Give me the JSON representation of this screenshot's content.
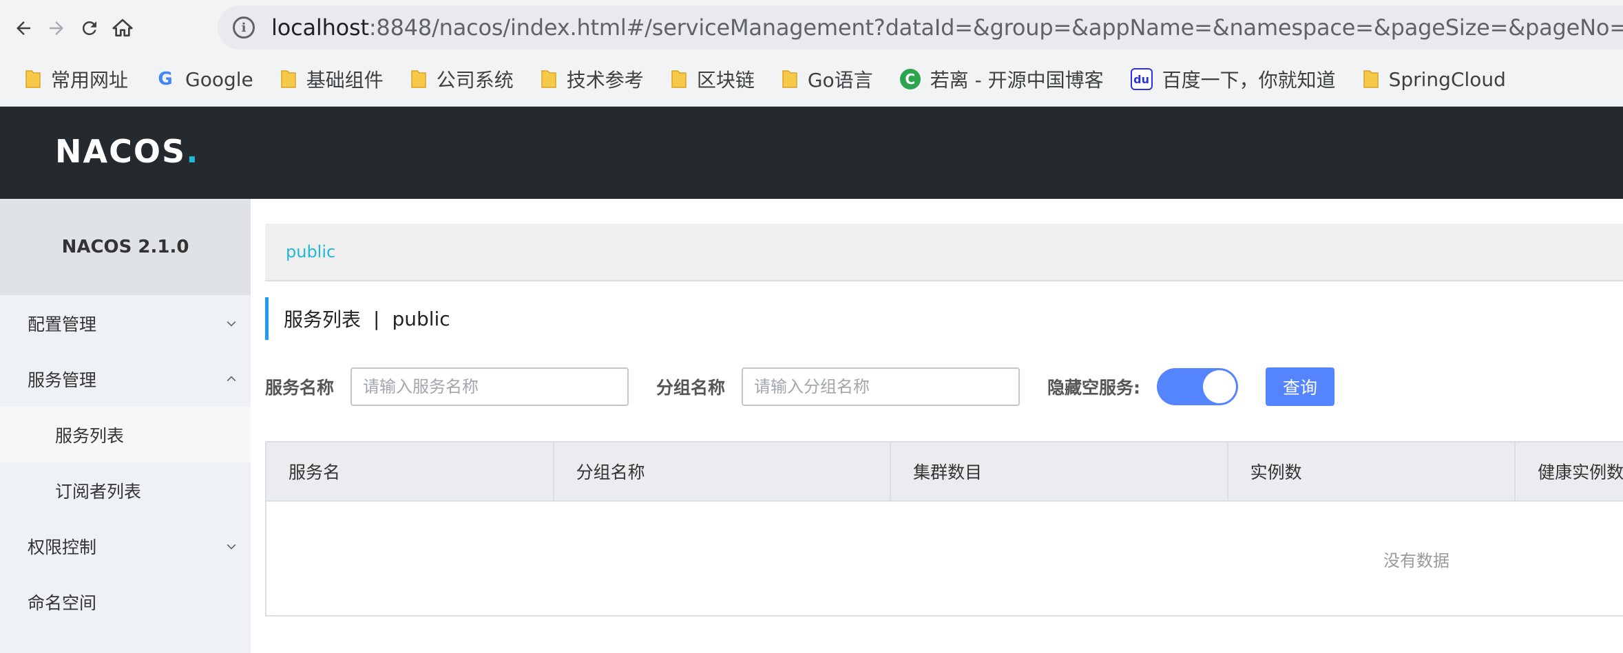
{
  "browser": {
    "url_host": "localhost",
    "url_rest": ":8848/nacos/index.html#/serviceManagement?dataId=&group=&appName=&namespace=&pageSize=&pageNo=",
    "bookmarks": [
      {
        "label": "常用网址",
        "icon": "folder-icon"
      },
      {
        "label": "Google",
        "icon": "google-icon"
      },
      {
        "label": "基础组件",
        "icon": "folder-icon"
      },
      {
        "label": "公司系统",
        "icon": "folder-icon"
      },
      {
        "label": "技术参考",
        "icon": "folder-icon"
      },
      {
        "label": "区块链",
        "icon": "folder-icon"
      },
      {
        "label": "Go语言",
        "icon": "folder-icon"
      },
      {
        "label": "若离 - 开源中国博客",
        "icon": "oschina-icon"
      },
      {
        "label": "百度一下，你就知道",
        "icon": "baidu-icon"
      },
      {
        "label": "SpringCloud",
        "icon": "folder-icon"
      }
    ]
  },
  "header": {
    "logo_main": "NACOS",
    "logo_dot": ".",
    "brand_color": "#21b8d6",
    "bg_color": "#252a2f"
  },
  "sidebar": {
    "version": "NACOS 2.1.0",
    "items": [
      {
        "label": "配置管理",
        "chevron": "down"
      },
      {
        "label": "服务管理",
        "chevron": "up"
      },
      {
        "label": "服务列表",
        "sub": true,
        "active": true
      },
      {
        "label": "订阅者列表",
        "sub": true
      },
      {
        "label": "权限控制",
        "chevron": "down"
      },
      {
        "label": "命名空间"
      }
    ]
  },
  "main": {
    "namespace": "public",
    "title": "服务列表",
    "title_sep": "|",
    "title_ns": "public",
    "filters": {
      "service_name_label": "服务名称",
      "service_name_placeholder": "请输入服务名称",
      "group_name_label": "分组名称",
      "group_name_placeholder": "请输入分组名称",
      "hide_empty_label": "隐藏空服务:",
      "hide_empty_on": true,
      "query_label": "查询"
    },
    "table": {
      "columns": [
        "服务名",
        "分组名称",
        "集群数目",
        "实例数",
        "健康实例数"
      ],
      "rows": [],
      "empty_text": "没有数据"
    }
  }
}
